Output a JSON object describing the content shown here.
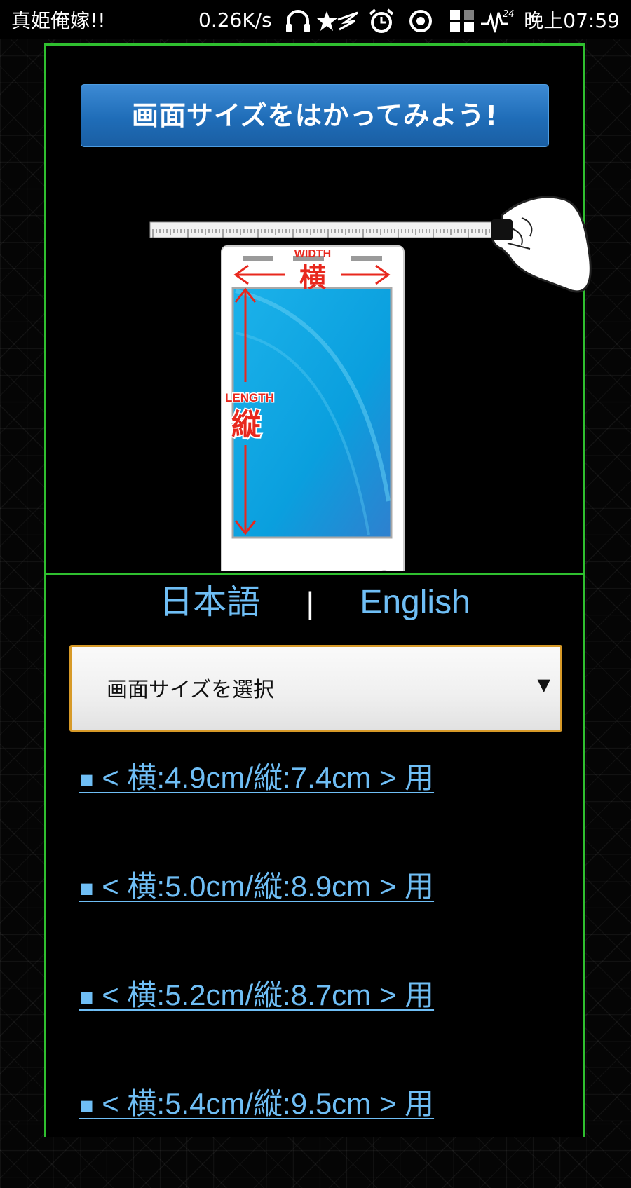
{
  "status_bar": {
    "app_name": "真姫俺嫁!!",
    "net_speed": "0.26K/s",
    "icons": [
      "headphones-icon",
      "star-icon",
      "alarm-icon",
      "location-icon",
      "qr-icon",
      "signal-icon"
    ],
    "signal_badge": "24",
    "time": "晚上07:59"
  },
  "banner": {
    "title": "画面サイズをはかってみよう!"
  },
  "illustration": {
    "width_en": "WIDTH",
    "width_jp": "横",
    "length_en": "LENGTH",
    "length_jp": "縦",
    "accent_color": "#e8281e",
    "screen_color": "#12a8e0"
  },
  "language": {
    "japanese": "日本語",
    "separator": "|",
    "english": "English"
  },
  "size_select": {
    "selected": "画面サイズを選択",
    "arrow": "▼"
  },
  "size_links": [
    {
      "bullet": "■",
      "label": "< 横:4.9cm/縦:7.4cm > 用"
    },
    {
      "bullet": "■",
      "label": "< 横:5.0cm/縦:8.9cm > 用"
    },
    {
      "bullet": "■",
      "label": "< 横:5.2cm/縦:8.7cm > 用"
    },
    {
      "bullet": "■",
      "label": "< 横:5.4cm/縦:9.5cm > 用"
    }
  ],
  "colors": {
    "frame_border": "#2fbf2f",
    "link": "#6fbef5",
    "select_border": "#d79a28",
    "banner": "#1f6db8"
  }
}
